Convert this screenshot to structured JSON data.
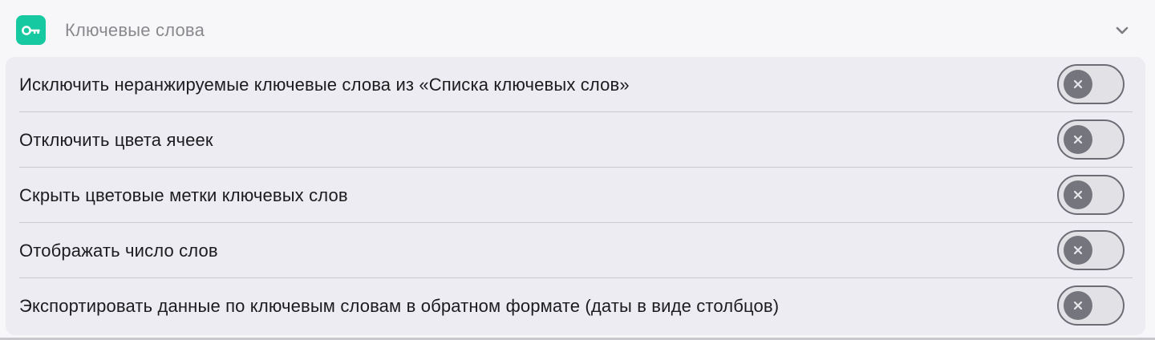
{
  "section": {
    "title": "Ключевые слова",
    "icon": "key-icon",
    "accent_color": "#16c9a0",
    "expand_icon": "chevron-down-icon"
  },
  "settings": {
    "items": [
      {
        "label": "Исключить неранжируемые ключевые слова из «Списка ключевых слов»",
        "enabled": false
      },
      {
        "label": "Отключить цвета ячеек",
        "enabled": false
      },
      {
        "label": "Скрыть цветовые метки ключевых слов",
        "enabled": false
      },
      {
        "label": "Отображать число слов",
        "enabled": false
      },
      {
        "label": "Экспортировать данные по ключевым словам в обратном формате (даты в виде столбцов)",
        "enabled": false
      }
    ],
    "toggle_off_icon": "close-icon"
  }
}
